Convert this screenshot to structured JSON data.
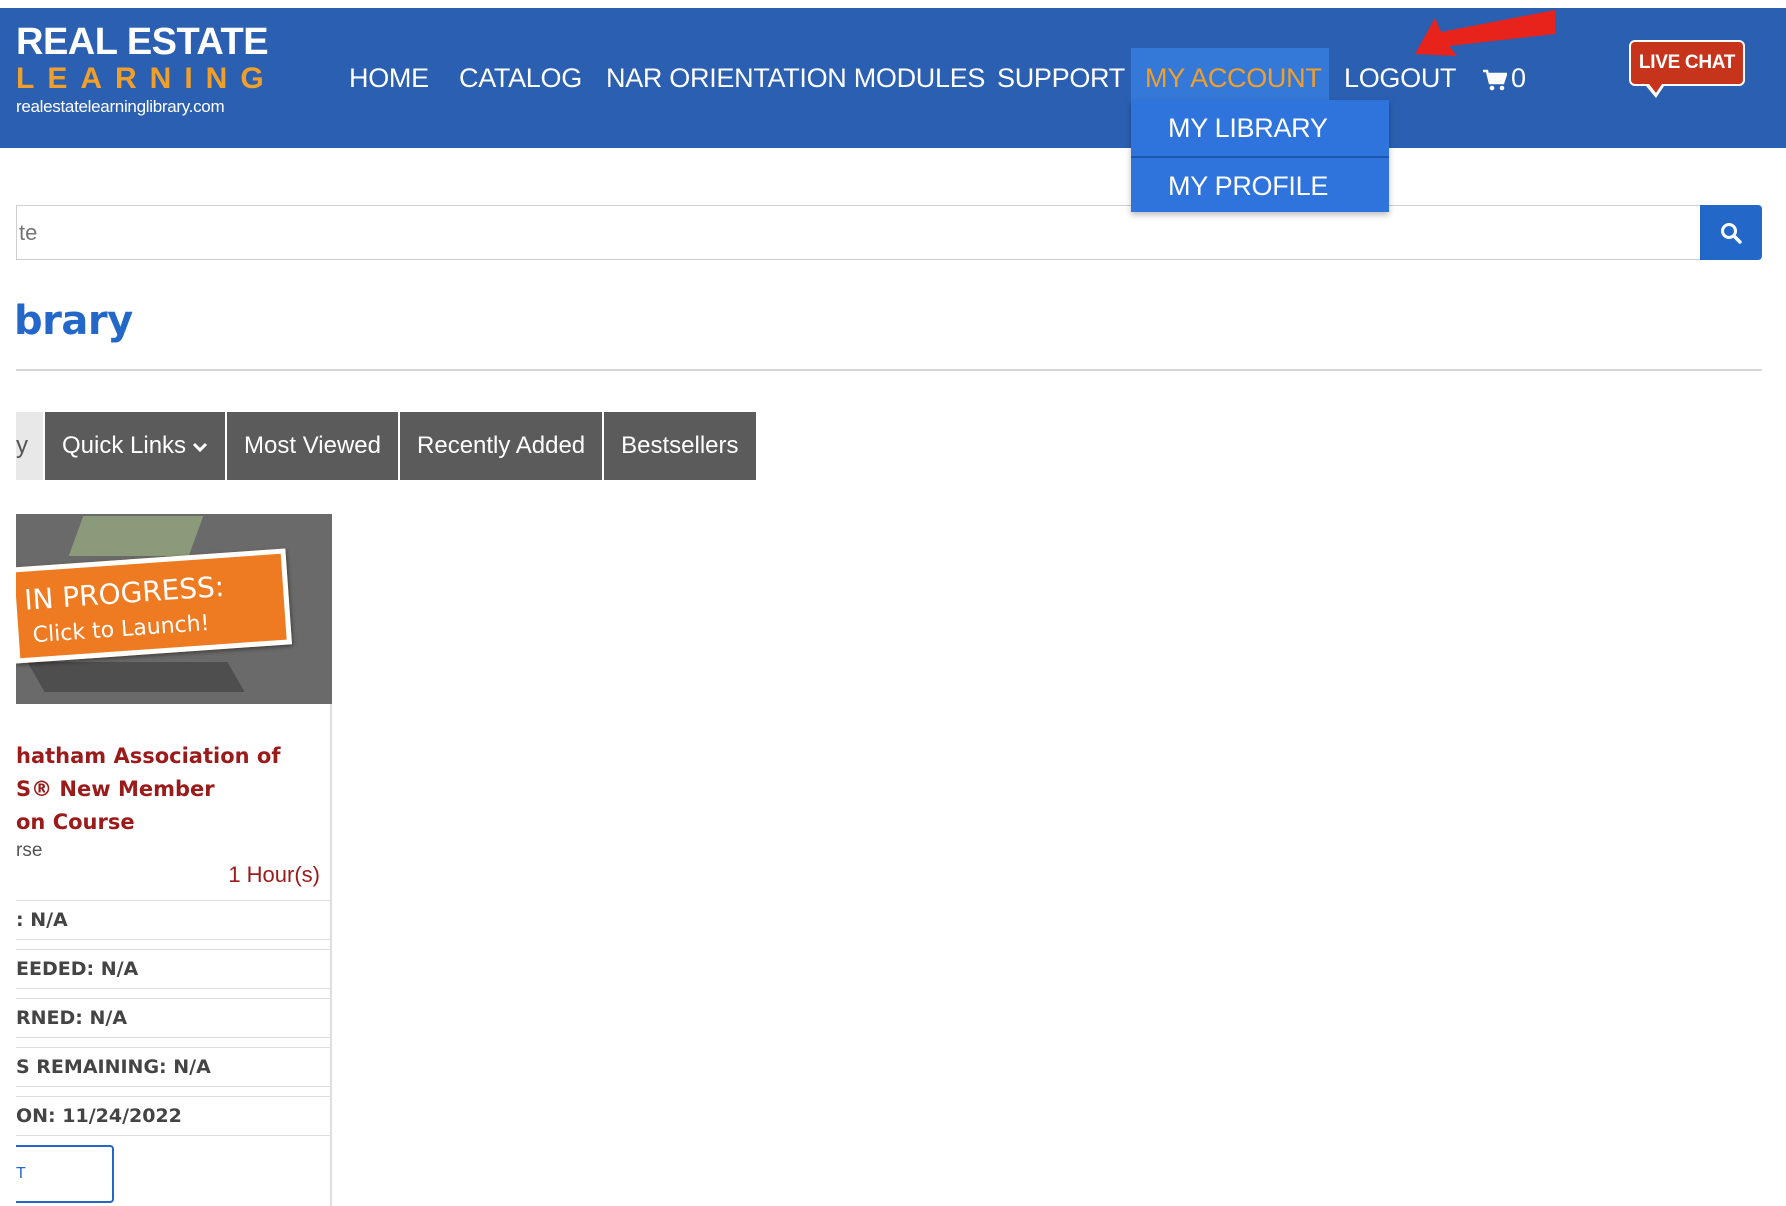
{
  "header": {
    "logo": {
      "line1": "REAL ESTATE",
      "line2": "LEARNING",
      "line3": "realestatelearninglibrary.com"
    },
    "nav": {
      "home": "HOME",
      "catalog": "CATALOG",
      "nar": "NAR ORIENTATION MODULES",
      "support": "SUPPORT",
      "account": "MY ACCOUNT",
      "logout": "LOGOUT",
      "cart_count": "0"
    },
    "live_chat": "LIVE CHAT"
  },
  "dropdown": {
    "items": [
      "MY LIBRARY",
      "MY PROFILE"
    ]
  },
  "search": {
    "placeholder": "te"
  },
  "page": {
    "title": "brary"
  },
  "tabs": {
    "first": "y",
    "quick_links": "Quick Links",
    "most_viewed": "Most Viewed",
    "recently_added": "Recently Added",
    "bestsellers": "Bestsellers"
  },
  "card": {
    "banner_line1": "IN PROGRESS:",
    "banner_line2": "Click to Launch!",
    "title_lines": [
      "hatham Association of",
      "S® New Member",
      "on Course"
    ],
    "type": "rse",
    "hours": "1 Hour(s)",
    "rows": [
      ": N/A",
      "EEDED: N/A",
      "RNED: N/A",
      "S REMAINING: N/A",
      "ON: 11/24/2022"
    ],
    "button": "T"
  },
  "colors": {
    "header_bg": "#2b5fb1",
    "accent_orange": "#f0a02a",
    "dropdown_bg": "#2e74dc",
    "link_blue": "#2367c9",
    "course_red": "#9b1a1a",
    "live_chat_red": "#c7341c",
    "tab_gray": "#5b5b5b"
  },
  "icons": {
    "cart": "cart-icon",
    "search": "search-icon",
    "chevron": "chevron-down-icon",
    "annotation": "red-arrow-icon"
  }
}
